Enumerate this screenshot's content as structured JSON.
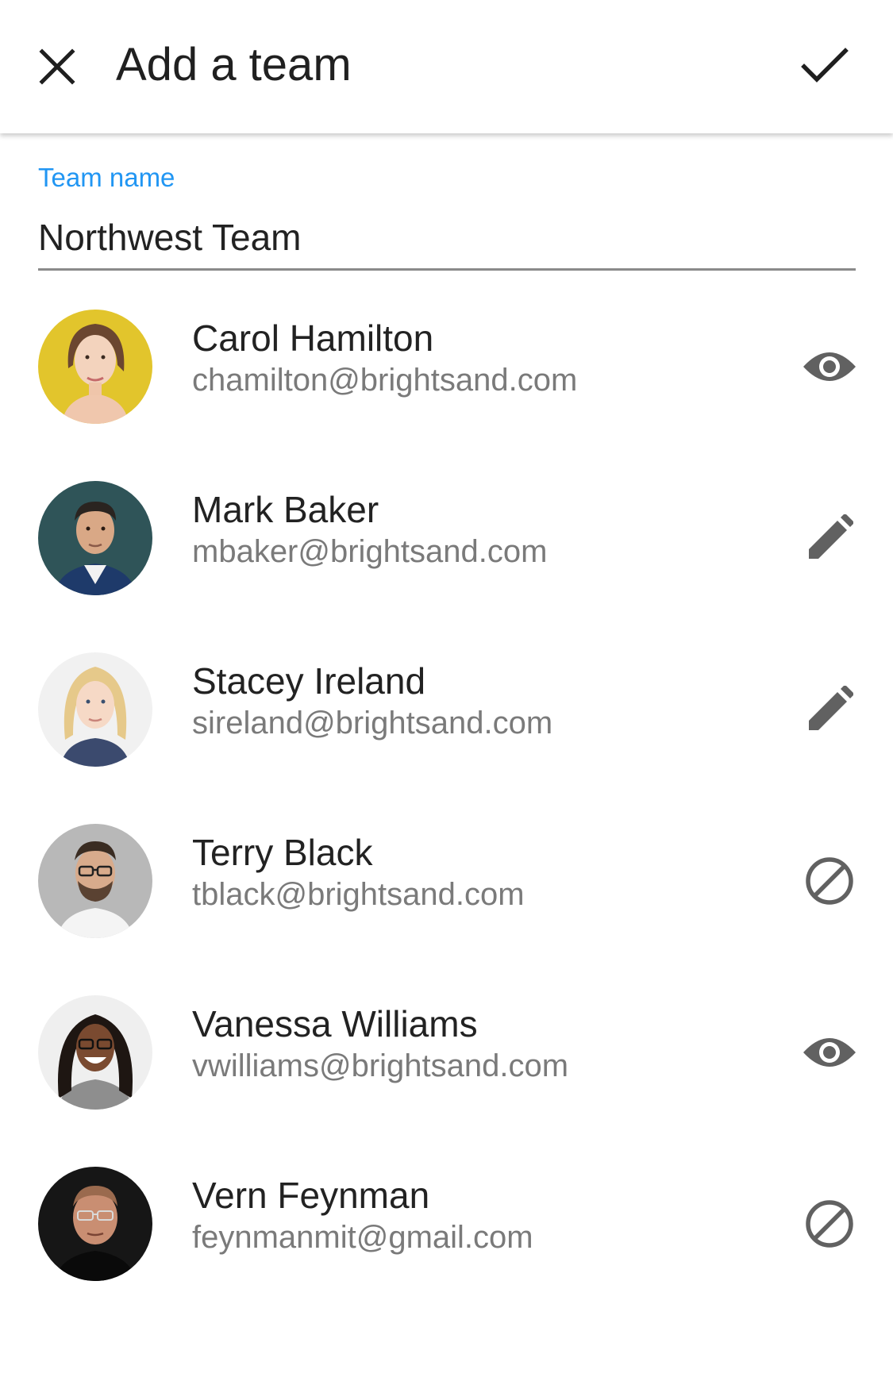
{
  "header": {
    "title": "Add a team",
    "close_icon": "close-icon",
    "confirm_icon": "check-icon"
  },
  "team_name_field": {
    "label": "Team name",
    "value": "Northwest Team"
  },
  "members": [
    {
      "name": "Carol Hamilton",
      "email": "chamilton@brightsand.com",
      "permission_icon": "eye-icon"
    },
    {
      "name": "Mark Baker",
      "email": "mbaker@brightsand.com",
      "permission_icon": "pencil-icon"
    },
    {
      "name": "Stacey Ireland",
      "email": "sireland@brightsand.com",
      "permission_icon": "pencil-icon"
    },
    {
      "name": "Terry Black",
      "email": "tblack@brightsand.com",
      "permission_icon": "block-icon"
    },
    {
      "name": "Vanessa Williams",
      "email": "vwilliams@brightsand.com",
      "permission_icon": "eye-icon"
    },
    {
      "name": "Vern Feynman",
      "email": "feynmanmit@gmail.com",
      "permission_icon": "block-icon"
    }
  ],
  "colors": {
    "accent": "#2196f3",
    "icon": "#616161",
    "text_primary": "#222222",
    "text_secondary": "#7a7a7a"
  }
}
